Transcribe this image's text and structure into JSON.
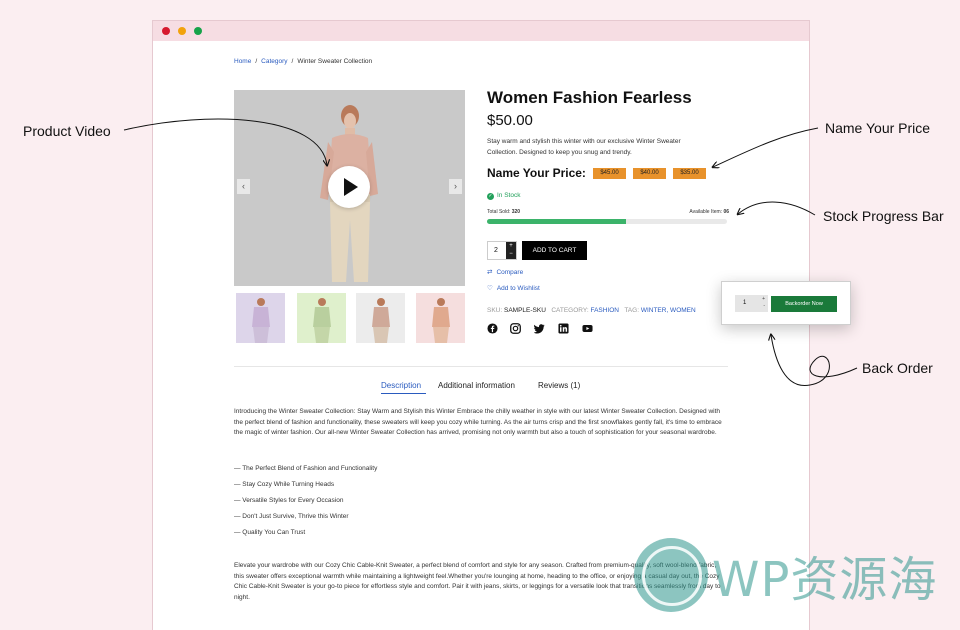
{
  "callouts": {
    "product_video": "Product Video",
    "name_your_price": "Name Your Price",
    "stock_progress_bar": "Stock Progress Bar",
    "back_order": "Back Order"
  },
  "breadcrumb": {
    "home": "Home",
    "category": "Category",
    "current": "Winter Sweater Collection"
  },
  "product": {
    "title": "Women Fashion Fearless",
    "price": "$50.00",
    "description": "Stay warm and stylish this winter with our exclusive Winter Sweater Collection. Designed to keep you snug and trendy.",
    "name_your_price_label": "Name Your Price:",
    "price_options": [
      "$45.00",
      "$40.00",
      "$35.00"
    ],
    "stock_status": "In Stock",
    "total_sold_label": "Total Sold:",
    "total_sold": "320",
    "available_label": "Available Item:",
    "available": "06",
    "stock_progress": 0.58,
    "quantity": "2",
    "add_to_cart": "ADD TO CART",
    "compare": "Compare",
    "wishlist": "Add to Wishlist",
    "sku_label": "SKU:",
    "sku": "SAMPLE-SKU",
    "category_label": "CATEGORY:",
    "category": "FASHION",
    "tag_label": "TAG:",
    "tags": "WINTER, WOMEN",
    "socials": [
      "facebook-icon",
      "instagram-icon",
      "twitter-icon",
      "linkedin-icon",
      "youtube-icon"
    ],
    "thumb_colors": [
      "#ddd5ea",
      "#dff0cc",
      "#ececec",
      "#f5dede"
    ]
  },
  "tabs": [
    "Description",
    "Additional information",
    "Reviews (1)"
  ],
  "description": {
    "intro": "Introducing the Winter Sweater Collection: Stay Warm and Stylish this Winter Embrace the chilly weather in style with our latest Winter Sweater Collection. Designed with the perfect blend of fashion and functionality, these sweaters will keep you cozy while turning. As the air turns crisp and the first snowflakes gently fall, it's time to embrace the magic of winter fashion. Our all-new Winter Sweater Collection has arrived, promising not only warmth but also a touch of sophistication for your seasonal wardrobe.",
    "features": [
      "— The Perfect Blend of Fashion and Functionality",
      "— Stay Cozy While Turning Heads",
      "— Versatile Styles for Every Occasion",
      "— Don't Just Survive, Thrive this Winter",
      "— Quality You Can Trust"
    ],
    "outro": "Elevate your wardrobe with our Cozy Chic Cable-Knit Sweater, a perfect blend of comfort and style for any season. Crafted from premium-quality, soft wool-blend fabric, this sweater offers exceptional warmth while maintaining a lightweight feel.Whether you're lounging at home, heading to the office, or enjoying a casual day out, the Cozy Chic Cable-Knit Sweater is your go-to piece for effortless style and comfort. Pair it with jeans, skirts, or leggings for a versatile look that transitions seamlessly from day to night."
  },
  "backorder": {
    "quantity": "1",
    "plus": "+",
    "minus": "-",
    "button": "Backorder Now"
  },
  "watermark": "WP资源海",
  "colors": {
    "accent_blue": "#2a5bbf",
    "price_chip": "#e8922b",
    "stock_green": "#3bb36a",
    "backorder_green": "#1a7a3a",
    "background": "#fbeef1"
  }
}
